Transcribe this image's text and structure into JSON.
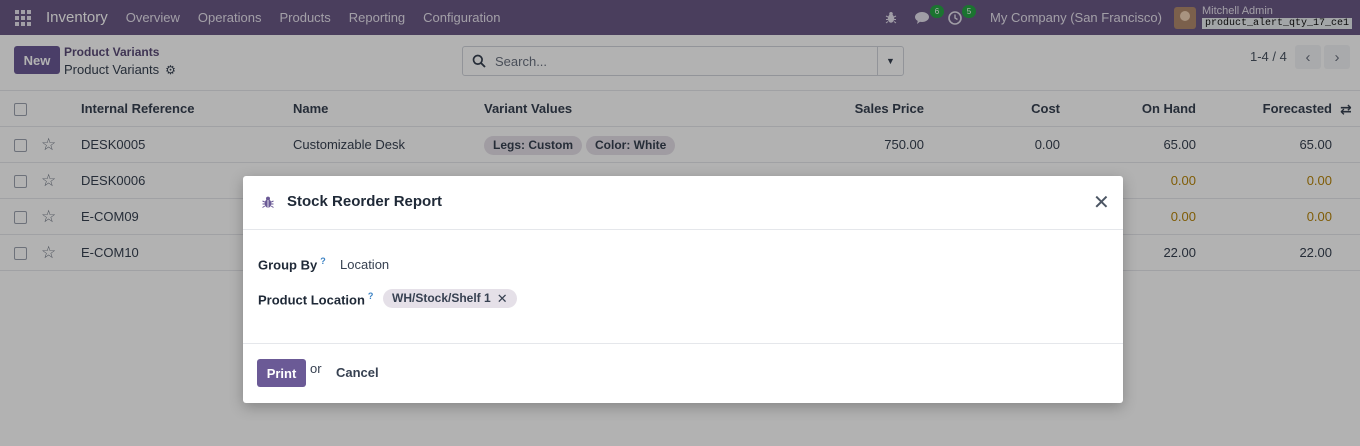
{
  "navbar": {
    "app_name": "Inventory",
    "menu": [
      "Overview",
      "Operations",
      "Products",
      "Reporting",
      "Configuration"
    ],
    "messages_badge": "6",
    "activities_badge": "5",
    "company": "My Company (San Francisco)",
    "user_name": "Mitchell Admin",
    "db_name": "product_alert_qty_17_ce1"
  },
  "control": {
    "new_label": "New",
    "breadcrumb_parent": "Product Variants",
    "breadcrumb_current": "Product Variants",
    "search_placeholder": "Search...",
    "pager": "1-4 / 4"
  },
  "table": {
    "columns": [
      "Internal Reference",
      "Name",
      "Variant Values",
      "Sales Price",
      "Cost",
      "On Hand",
      "Forecasted"
    ],
    "rows": [
      {
        "ref": "DESK0005",
        "name": "Customizable Desk",
        "tags": [
          "Legs: Custom",
          "Color: White"
        ],
        "price": "750.00",
        "cost": "0.00",
        "on_hand": "65.00",
        "forecasted": "65.00"
      },
      {
        "ref": "DESK0006",
        "on_hand": "0.00",
        "forecasted": "0.00"
      },
      {
        "ref": "E-COM09",
        "on_hand": "0.00",
        "forecasted": "0.00"
      },
      {
        "ref": "E-COM10",
        "on_hand": "22.00",
        "forecasted": "22.00"
      }
    ]
  },
  "modal": {
    "title": "Stock Reorder Report",
    "group_by_label": "Group By",
    "group_by_help": "?",
    "group_by_value": "Location",
    "location_label": "Product Location",
    "location_help": "?",
    "location_tag": "WH/Stock/Shelf 1",
    "print_label": "Print",
    "or_text": "or",
    "cancel_label": "Cancel"
  },
  "colors": {
    "navbar": "#6b5a86",
    "primary": "#6b5a96",
    "warning_text": "#b8860b",
    "badge": "#28a745"
  }
}
